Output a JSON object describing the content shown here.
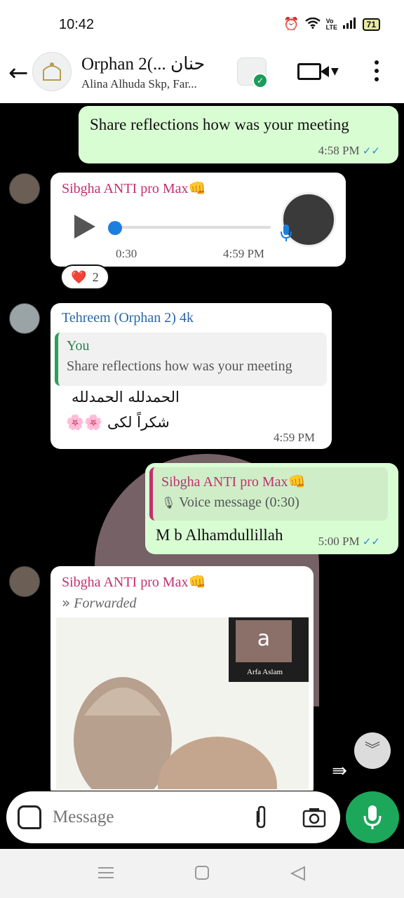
{
  "status_bar": {
    "time": "10:42",
    "network": "Vo LTE",
    "battery": "71"
  },
  "header": {
    "title": "Orphan 2(... حنان",
    "subtitle": "Alina Alhuda Skp, Far..."
  },
  "messages": [
    {
      "id": "m1",
      "direction": "out",
      "text": "Share reflections how was your meeting",
      "time": "4:58 PM"
    },
    {
      "id": "m2",
      "direction": "in",
      "sender": "Sibgha ANTI pro Max👊",
      "type": "voice",
      "duration": "0:30",
      "time": "4:59 PM",
      "reaction": {
        "emoji": "❤️",
        "count": "2"
      }
    },
    {
      "id": "m3",
      "direction": "in",
      "sender": "Tehreem (Orphan 2) 4k",
      "quote": {
        "author": "You",
        "text": "Share reflections how was your meeting"
      },
      "line1": "الحمدلله الحمدلله",
      "line2": "شکراً لکی 🌸🌸",
      "time": "4:59 PM"
    },
    {
      "id": "m4",
      "direction": "out",
      "quote": {
        "author": "Sibgha ANTI pro Max👊",
        "text": "Voice message (0:30)"
      },
      "text": "M b Alhamdullillah",
      "time": "5:00 PM"
    },
    {
      "id": "m5",
      "direction": "in",
      "sender": "Sibgha ANTI pro Max👊",
      "forwarded_label": "Forwarded",
      "image": {
        "tile_letter": "a",
        "tile_name": "Arfa Aslam"
      }
    }
  ],
  "composer": {
    "placeholder": "Message"
  },
  "icons": {
    "back": "back-arrow-icon",
    "video": "video-call-icon",
    "menu": "more-vertical-icon",
    "sticker": "sticker-icon",
    "attach": "paperclip-icon",
    "camera": "camera-icon",
    "mic": "mic-icon"
  },
  "colors": {
    "outgoing": "#d9fdd3",
    "incoming": "#ffffff",
    "accent": "#1da75a",
    "ticks": "#2a8bd8"
  }
}
